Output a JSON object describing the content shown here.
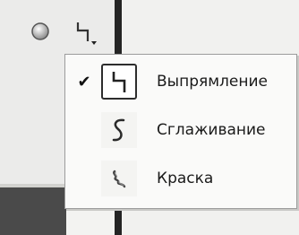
{
  "toolbar": {
    "ellipse_tool_icon": "ellipse-icon",
    "straighten_tool_icon": "straighten-line-icon"
  },
  "menu": {
    "items": [
      {
        "label": "Выпрямление",
        "icon": "straighten-line-icon",
        "checked": true
      },
      {
        "label": "Сглаживание",
        "icon": "smooth-curve-icon",
        "checked": false
      },
      {
        "label": "Краска",
        "icon": "paint-stroke-icon",
        "checked": false
      }
    ],
    "check_mark": "✔"
  }
}
